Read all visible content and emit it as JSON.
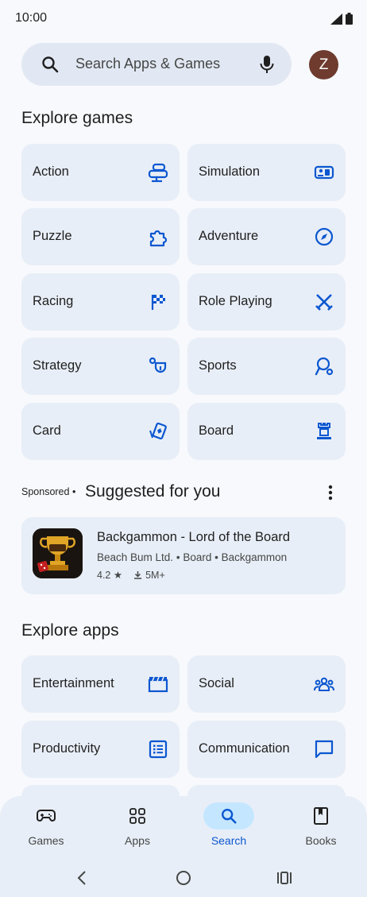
{
  "status": {
    "time": "10:00"
  },
  "search": {
    "placeholder": "Search Apps & Games",
    "avatar_letter": "Z"
  },
  "games_section": {
    "title": "Explore games",
    "tiles": [
      {
        "label": "Action",
        "icon": "action-icon"
      },
      {
        "label": "Simulation",
        "icon": "simulation-icon"
      },
      {
        "label": "Puzzle",
        "icon": "puzzle-icon"
      },
      {
        "label": "Adventure",
        "icon": "compass-icon"
      },
      {
        "label": "Racing",
        "icon": "checkered-flag-icon"
      },
      {
        "label": "Role Playing",
        "icon": "swords-icon"
      },
      {
        "label": "Strategy",
        "icon": "strategy-icon"
      },
      {
        "label": "Sports",
        "icon": "sports-icon"
      },
      {
        "label": "Card",
        "icon": "card-icon"
      },
      {
        "label": "Board",
        "icon": "chess-rook-icon"
      }
    ]
  },
  "suggested": {
    "sponsored_label": "Sponsored",
    "separator": "•",
    "title": "Suggested for you",
    "app": {
      "name": "Backgammon - Lord of the Board",
      "developer": "Beach Bum Ltd.",
      "category": "Board",
      "genre": "Backgammon",
      "rating": "4.2",
      "downloads": "5M+"
    }
  },
  "apps_section": {
    "title": "Explore apps",
    "tiles": [
      {
        "label": "Entertainment",
        "icon": "clapperboard-icon"
      },
      {
        "label": "Social",
        "icon": "people-icon"
      },
      {
        "label": "Productivity",
        "icon": "checklist-icon"
      },
      {
        "label": "Communication",
        "icon": "chat-bubble-icon"
      }
    ]
  },
  "bottom_nav": {
    "items": [
      {
        "label": "Games",
        "icon": "gamepad-icon"
      },
      {
        "label": "Apps",
        "icon": "apps-grid-icon"
      },
      {
        "label": "Search",
        "icon": "search-icon",
        "active": true
      },
      {
        "label": "Books",
        "icon": "book-icon"
      }
    ]
  },
  "colors": {
    "accent": "#0b57d0",
    "tile_bg": "#e8eef7",
    "active_pill": "#c4e7ff"
  }
}
